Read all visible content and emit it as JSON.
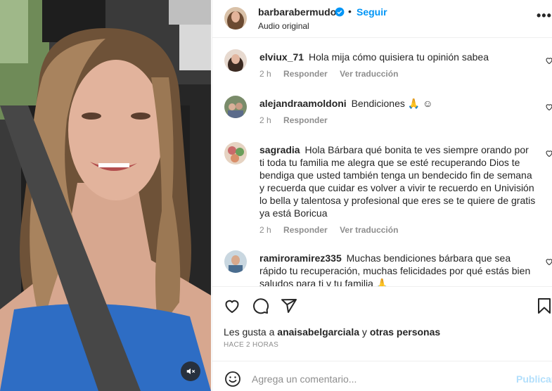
{
  "post": {
    "username": "barbarabermudo",
    "subtitle": "Audio original",
    "follow_label": "Seguir",
    "separator": "•",
    "more_label": "•••"
  },
  "comments": [
    {
      "username": "elviux_71",
      "text": "Hola mija cómo quisiera tu opinión sabea",
      "time": "2 h",
      "reply_label": "Responder",
      "translate_label": "Ver traducción"
    },
    {
      "username": "alejandraamoldoni",
      "text": "Bendiciones 🙏 ☺",
      "time": "2 h",
      "reply_label": "Responder",
      "translate_label": ""
    },
    {
      "username": "sagradia",
      "text": "Hola Bárbara qué bonita te ves siempre orando por ti toda tu familia me alegra que se esté recuperando Dios te bendiga que usted también tenga un bendecido fin de semana y recuerda que cuidar es volver a vivir te recuerdo en Univisión lo bella y talentosa y profesional que eres se te quiere de gratis ya está Boricua",
      "time": "2 h",
      "reply_label": "Responder",
      "translate_label": "Ver traducción"
    },
    {
      "username": "ramiroramirez335",
      "text": "Muchas bendiciones bárbara que sea rápido tu recuperación, muchas felicidades por qué estás bien saludos para ti y tu familia 🙏",
      "time": "",
      "reply_label": "",
      "translate_label": ""
    }
  ],
  "likes": {
    "prefix": "Les gusta a ",
    "user": "anaisabelgarciala",
    "middle": " y ",
    "others": "otras personas"
  },
  "time_ago": "HACE 2 HORAS",
  "composer": {
    "placeholder": "Agrega un comentario...",
    "post_label": "Publicar"
  },
  "icons": {
    "verified": "verified-badge-icon",
    "like": "heart-icon",
    "comment": "comment-bubble-icon",
    "share": "paper-plane-icon",
    "save": "bookmark-icon",
    "emoji": "smiley-icon",
    "mute": "speaker-muted-icon"
  },
  "colors": {
    "link_blue": "#0095f6",
    "post_disabled": "#b2dffc",
    "secondary_text": "#8e8e8e",
    "border": "#efefef"
  }
}
